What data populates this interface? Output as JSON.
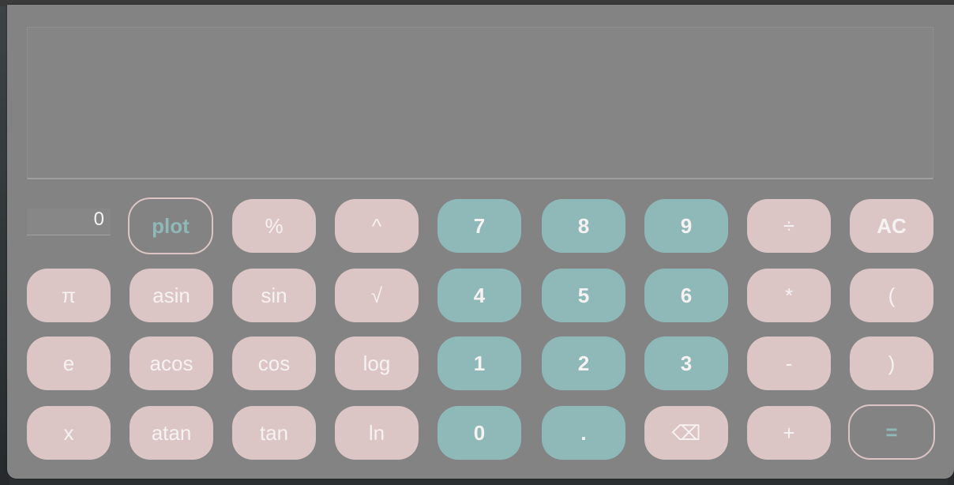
{
  "display": {
    "value": "0"
  },
  "buttons": {
    "plot": "plot",
    "percent": "%",
    "caret": "^",
    "d7": "7",
    "d8": "8",
    "d9": "9",
    "divide": "÷",
    "ac": "AC",
    "pi": "π",
    "asin": "asin",
    "sin": "sin",
    "sqrt": "√",
    "d4": "4",
    "d5": "5",
    "d6": "6",
    "multiply": "*",
    "lparen": "(",
    "e": "e",
    "acos": "acos",
    "cos": "cos",
    "log": "log",
    "d1": "1",
    "d2": "2",
    "d3": "3",
    "minus": "-",
    "rparen": ")",
    "x": "x",
    "atan": "atan",
    "tan": "tan",
    "ln": "ln",
    "d0": "0",
    "dot": ".",
    "backspace": "⌫",
    "plus": "+",
    "equals": "="
  },
  "colors": {
    "function_button": "#dcc5c5",
    "digit_button": "#8fb8b8",
    "panel": "#838383"
  }
}
